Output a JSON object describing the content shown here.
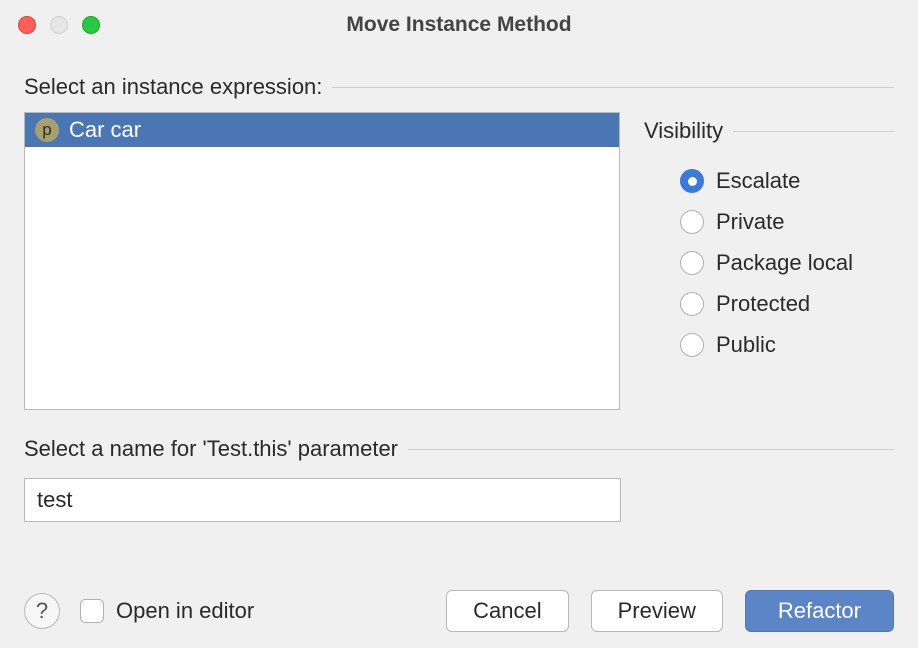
{
  "window": {
    "title": "Move Instance Method"
  },
  "instance_section": {
    "label": "Select an instance expression:",
    "items": [
      {
        "badge": "p",
        "text": "Car car",
        "selected": true
      }
    ]
  },
  "visibility": {
    "label": "Visibility",
    "options": [
      {
        "label": "Escalate",
        "checked": true
      },
      {
        "label": "Private",
        "checked": false
      },
      {
        "label": "Package local",
        "checked": false
      },
      {
        "label": "Protected",
        "checked": false
      },
      {
        "label": "Public",
        "checked": false
      }
    ]
  },
  "param": {
    "label": "Select a name for 'Test.this' parameter",
    "value": "test"
  },
  "footer": {
    "help": "?",
    "open_in_editor": "Open in editor",
    "cancel": "Cancel",
    "preview": "Preview",
    "refactor": "Refactor"
  }
}
